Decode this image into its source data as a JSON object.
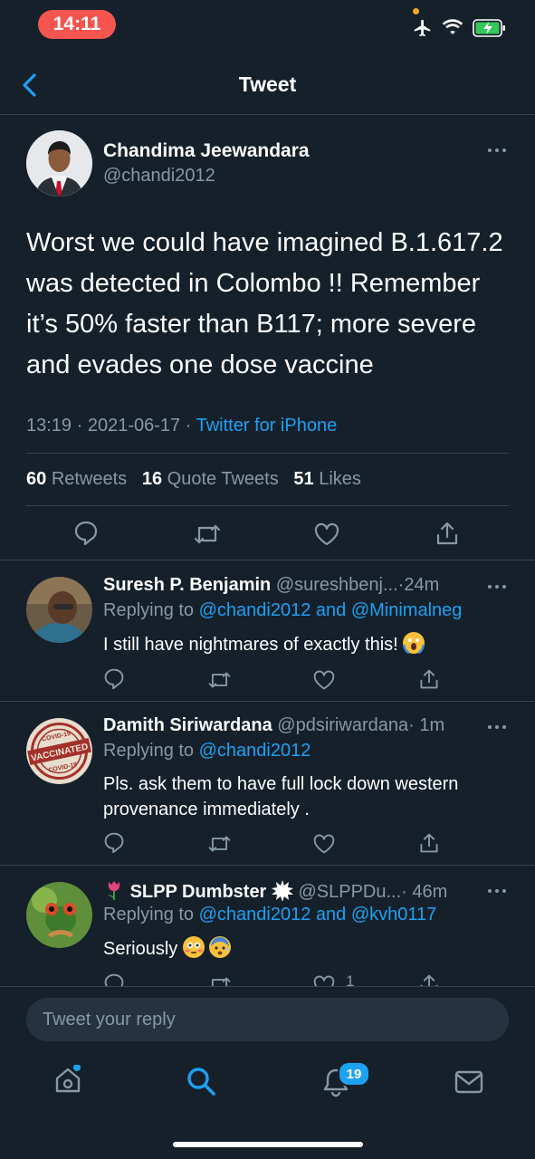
{
  "status_bar": {
    "time": "14:11"
  },
  "nav": {
    "title": "Tweet"
  },
  "tweet": {
    "author_name": "Chandima Jeewandara",
    "author_handle": "@chandi2012",
    "text": "Worst we could have imagined B.1.617.2 was detected in Colombo !! Remember it’s 50% faster than B117; more severe and evades one dose vaccine",
    "time": "13:19",
    "sep1": " · ",
    "date": "2021-06-17",
    "sep2": " · ",
    "source": "Twitter for iPhone",
    "retweets_count": "60",
    "retweets_label": "Retweets",
    "quotes_count": "16",
    "quotes_label": "Quote Tweets",
    "likes_count": "51",
    "likes_label": "Likes"
  },
  "replies": [
    {
      "name": "Suresh P. Benjamin",
      "handle": "@sureshbenj...",
      "time": "·24m",
      "replying_prefix": "Replying to",
      "replying_to": "@chandi2012 and @Minimalneg",
      "text": "I still have nightmares of exactly this!",
      "like_count": ""
    },
    {
      "name": "Damith Siriwardana",
      "handle": "@pdsiriwardana",
      "time": "· 1m",
      "replying_prefix": "Replying to",
      "replying_to": "@chandi2012",
      "text": "Pls.  ask them to have full lock down western provenance immediately .",
      "like_count": ""
    },
    {
      "name": "SLPP Dumbster",
      "handle": "@SLPPDu...",
      "time": "· 46m",
      "replying_prefix": "Replying to",
      "replying_to": "@chandi2012 and @kvh0117",
      "text": "Seriously",
      "like_count": "1"
    }
  ],
  "vaccinated_stamp": {
    "top": "COVID-19",
    "middle": "VACCINATED",
    "bottom": "COVID-19"
  },
  "composer": {
    "placeholder": "Tweet your reply"
  },
  "tab_bar": {
    "notifications_badge": "19"
  },
  "colors": {
    "background": "#15202b",
    "accent": "#1da1f2",
    "muted": "#8899a6",
    "divider": "#38444d",
    "time_pill": "#f5554f"
  }
}
